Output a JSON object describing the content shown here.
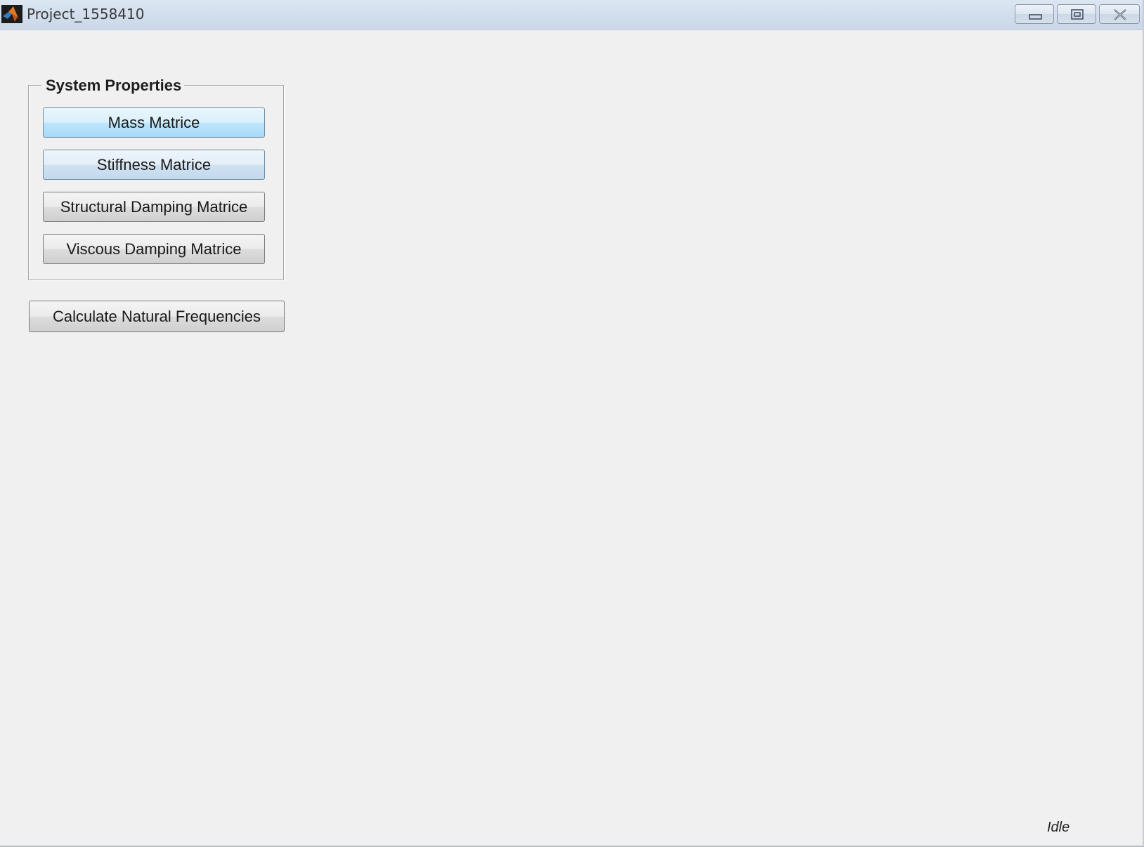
{
  "window": {
    "title": "Project_1558410",
    "icon": "matlab-icon"
  },
  "titlebar_buttons": {
    "minimize": "minimize-icon",
    "maximize": "restore-icon",
    "close": "close-icon"
  },
  "system_properties": {
    "title": "System Properties",
    "buttons": [
      {
        "label": "Mass Matrice"
      },
      {
        "label": "Stiffness Matrice"
      },
      {
        "label": "Structural Damping Matrice"
      },
      {
        "label": "Viscous Damping Matrice"
      }
    ]
  },
  "calculate_button": {
    "label": "Calculate Natural Frequencies"
  },
  "status": {
    "text": "Idle"
  },
  "colors": {
    "background": "#f0f0f0",
    "titlebar": "#d3dfee",
    "button_blue": "#bee6fd",
    "button_gray": "#dddddd"
  }
}
